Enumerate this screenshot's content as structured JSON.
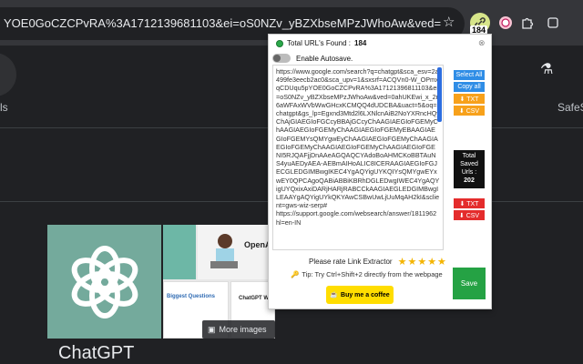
{
  "browser": {
    "url_text": "YOE0GoCZCPvRA%3A1712139681103&ei=oS0NZv_yBZXbseMPzJWhoAw&ved=0ahUKEwi_x_2r6aWFAxWVbW",
    "extension_badge": "184"
  },
  "page": {
    "left_text": "ls",
    "right_text": "SafeS",
    "openai_label": "OpenAI",
    "thumb_title_1": "Biggest Questions",
    "thumb_title_2": "ChatGPT W",
    "more_images": "More images",
    "kp_title": "ChatGPT"
  },
  "popup": {
    "header_label": "Total URL's Found :",
    "count": "184",
    "autosave_label": "Enable Autosave.",
    "url_list": "https://www.google.com/search?q=chatgpt&sca_esv=2a499fe3eecb2ac0&sca_upv=1&sxsrf=ACQVn0-W_OPmxqCDUqu5pYOE0GoCZCPvRA%3A17121396811103&ei=oS0NZv_yBZXbseMPzJWhoAw&ved=0ahUKEwi_x_2r6aWFAxWVbWwGHcxKCMQQ4dUDCBA&uact=5&oq=chatgpt&gs_lp=Egxnd3Mtd2l6LXNlcnAiB2NoYXRncHQyChAjGIAEGIoFGCcyBBAjGCcyChAAGIAEGIoFGEMyChAAGIAEGIoFGEMyChAAGIAEGIoFGEMyEBAAGIAEGIoFGEMYsQMYgwEyChAAGIAEGIoFGEMyChAAGIAEGIoFGEMyChAAGIAEGIoFGEMyChAAGIAEGIoFGENI5RJQAFjjDnAAeAGQAQCYAdoBoAHMCKoBBTAuNS4yuAEDyAEA-AEBmAIHoALIC8ICERAAGIAEGIoFGJECGLEDGIMBwgIKEC4YgAQYigUYKQIYsQMYgwEYxwEY0QPCAgoQABiABBiKBRhDGLEDwgIWEC4YgAQYigUYQxixAxiDARjHARjRABCCkAAGIAEGLEDGIMBwgILEAAYgAQYigUYkQKYAwCSBwUwLjUuMqAH2kI&sclient=gws-wiz-serp#\nhttps://support.google.com/websearch/answer/1811962hl=en-IN",
    "select_all": "Select All",
    "copy_all": "Copy all",
    "txt_top": "⬇ TXT",
    "csv_top": "⬇ CSV",
    "saved_line1": "Total",
    "saved_line2": "Saved",
    "saved_line3": "Urls :",
    "saved_count": "202",
    "txt_bottom": "⬇ TXT",
    "csv_bottom": "⬇ CSV",
    "rate_text": "Please rate Link Extractor",
    "stars": "★★★★★",
    "tip_text": "Tip: Try Ctrl+Shift+2 directly from the webpage",
    "coffee_text": "Buy me a coffee",
    "save_label": "Save"
  },
  "colors": {
    "accent_blue": "#2f8de6",
    "accent_orange": "#f7a11b",
    "accent_red": "#e42c2c",
    "save_green": "#25a244",
    "coffee_yellow": "#ffdd00"
  }
}
